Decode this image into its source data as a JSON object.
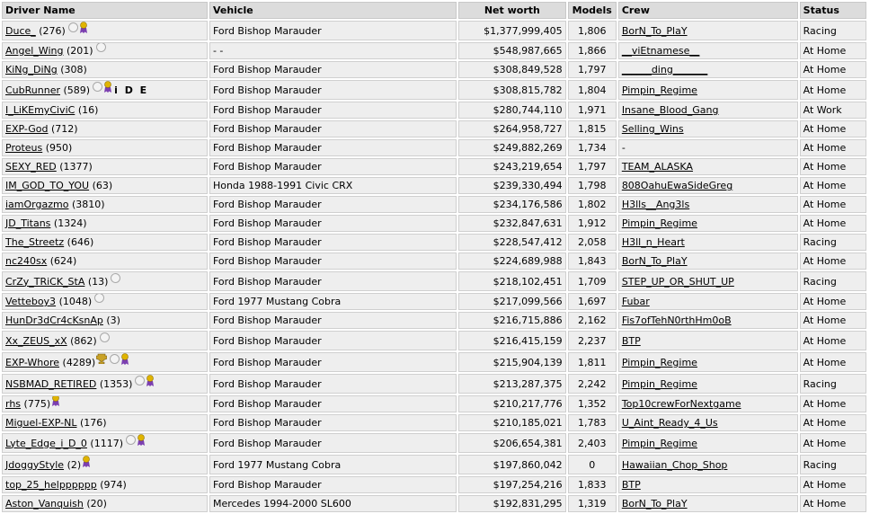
{
  "headers": {
    "driver": "Driver Name",
    "vehicle": "Vehicle",
    "networth": "Net worth",
    "models": "Models",
    "crew": "Crew",
    "status": "Status"
  },
  "rows": [
    {
      "driver": "Duce_",
      "rank": "(276)",
      "vehicle": "Ford Bishop Marauder",
      "networth": "$1,377,999,405",
      "models": "1,806",
      "crew": "BorN_To_PlaY",
      "status": "Racing",
      "coin": true,
      "award": true,
      "tall": true
    },
    {
      "driver": "Angel_Wing",
      "rank": "(201)",
      "vehicle": "- -",
      "networth": "$548,987,665",
      "models": "1,866",
      "crew": "__viEtnamese__",
      "status": "At Home",
      "coin": true
    },
    {
      "driver": "KiNg_DiNg",
      "rank": "(308)",
      "vehicle": "Ford Bishop Marauder",
      "networth": "$308,849,528",
      "models": "1,797",
      "crew": "______ding_______",
      "status": "At Home"
    },
    {
      "driver": "CubRunner",
      "rank": "(589)",
      "vehicle": "Ford Bishop Marauder",
      "networth": "$308,815,782",
      "models": "1,804",
      "crew": "Pimpin_Regime",
      "status": "At Home",
      "coin": true,
      "award": true,
      "ide": "i D E",
      "tall": true
    },
    {
      "driver": "I_LiKEmyCiviC",
      "rank": "(16)",
      "vehicle": "Ford Bishop Marauder",
      "networth": "$280,744,110",
      "models": "1,971",
      "crew": "Insane_Blood_Gang",
      "status": "At Work"
    },
    {
      "driver": "EXP-God",
      "rank": "(712)",
      "vehicle": "Ford Bishop Marauder",
      "networth": "$264,958,727",
      "models": "1,815",
      "crew": "Selling_Wins",
      "status": "At Home"
    },
    {
      "driver": "Proteus",
      "rank": "(950)",
      "vehicle": "Ford Bishop Marauder",
      "networth": "$249,882,269",
      "models": "1,734",
      "crew": "-",
      "crew_plain": true,
      "status": "At Home"
    },
    {
      "driver": "SEXY_RED",
      "rank": "(1377)",
      "vehicle": "Ford Bishop Marauder",
      "networth": "$243,219,654",
      "models": "1,797",
      "crew": "TEAM_ALASKA",
      "status": "At Home"
    },
    {
      "driver": "IM_GOD_TO_YOU",
      "rank": "(63)",
      "vehicle": "Honda 1988-1991 Civic CRX",
      "networth": "$239,330,494",
      "models": "1,798",
      "crew": "808OahuEwaSideGreg",
      "status": "At Home"
    },
    {
      "driver": "iamOrgazmo",
      "rank": "(3810)",
      "vehicle": "Ford Bishop Marauder",
      "networth": "$234,176,586",
      "models": "1,802",
      "crew": "H3lls__Ang3ls",
      "status": "At Home"
    },
    {
      "driver": "JD_Titans",
      "rank": "(1324)",
      "vehicle": "Ford Bishop Marauder",
      "networth": "$232,847,631",
      "models": "1,912",
      "crew": "Pimpin_Regime",
      "status": "At Home"
    },
    {
      "driver": "The_Streetz",
      "rank": "(646)",
      "vehicle": "Ford Bishop Marauder",
      "networth": "$228,547,412",
      "models": "2,058",
      "crew": "H3ll_n_Heart",
      "status": "Racing"
    },
    {
      "driver": "nc240sx",
      "rank": "(624)",
      "vehicle": "Ford Bishop Marauder",
      "networth": "$224,689,988",
      "models": "1,843",
      "crew": "BorN_To_PlaY",
      "status": "At Home"
    },
    {
      "driver": "CrZy_TRiCK_StA",
      "rank": "(13)",
      "vehicle": "Ford Bishop Marauder",
      "networth": "$218,102,451",
      "models": "1,709",
      "crew": "STEP_UP_OR_SHUT_UP",
      "status": "Racing",
      "coin": true,
      "tall": true
    },
    {
      "driver": "Vetteboy3",
      "rank": "(1048)",
      "vehicle": "Ford 1977 Mustang Cobra",
      "networth": "$217,099,566",
      "models": "1,697",
      "crew": "Fubar",
      "status": "At Home",
      "coin": true
    },
    {
      "driver": "HunDr3dCr4cKsnAp",
      "rank": "(3)",
      "vehicle": "Ford Bishop Marauder",
      "networth": "$216,715,886",
      "models": "2,162",
      "crew": "Fis7ofTehN0rthHm0oB",
      "status": "At Home"
    },
    {
      "driver": "Xx_ZEUS_xX",
      "rank": "(862)",
      "vehicle": "Ford Bishop Marauder",
      "networth": "$216,415,159",
      "models": "2,237",
      "crew": "BTP",
      "status": "At Home",
      "coin": true,
      "tall": true
    },
    {
      "driver": "EXP-Whore",
      "rank": "(4289)",
      "vehicle": "Ford Bishop Marauder",
      "networth": "$215,904,139",
      "models": "1,811",
      "crew": "Pimpin_Regime",
      "status": "At Home",
      "trophy": true,
      "coin": true,
      "award": true,
      "tall": true
    },
    {
      "driver": "NSBMAD_RETIRED",
      "rank": "(1353)",
      "vehicle": "Ford Bishop Marauder",
      "networth": "$213,287,375",
      "models": "2,242",
      "crew": "Pimpin_Regime",
      "status": "Racing",
      "coin": true,
      "award": true,
      "tall": true
    },
    {
      "driver": "rhs",
      "rank": "(775)",
      "vehicle": "Ford Bishop Marauder",
      "networth": "$210,217,776",
      "models": "1,352",
      "crew": "Top10crewForNextgame",
      "status": "At Home",
      "award": true
    },
    {
      "driver": "Miguel-EXP-NL",
      "rank": "(176)",
      "vehicle": "Ford Bishop Marauder",
      "networth": "$210,185,021",
      "models": "1,783",
      "crew": "U_Aint_Ready_4_Us",
      "status": "At Home"
    },
    {
      "driver": "Lyte_Edge_i_D_0",
      "rank": "(1117)",
      "vehicle": "Ford Bishop Marauder",
      "networth": "$206,654,381",
      "models": "2,403",
      "crew": "Pimpin_Regime",
      "status": "At Home",
      "coin": true,
      "award": true,
      "tall": true
    },
    {
      "driver": "JdoggyStyle",
      "rank": "(2)",
      "vehicle": "Ford 1977 Mustang Cobra",
      "networth": "$197,860,042",
      "models": "0",
      "crew": "Hawaiian_Chop_Shop",
      "status": "Racing",
      "award": true,
      "tall": true
    },
    {
      "driver": "top_25_helpppppp",
      "rank": "(974)",
      "vehicle": "Ford Bishop Marauder",
      "networth": "$197,254,216",
      "models": "1,833",
      "crew": "BTP",
      "status": "At Home"
    },
    {
      "driver": "Aston_Vanquish",
      "rank": "(20)",
      "vehicle": "Mercedes 1994-2000 SL600",
      "networth": "$192,831,295",
      "models": "1,319",
      "crew": "BorN_To_PlaY",
      "status": "At Home"
    }
  ],
  "colors": {
    "award_ribbon": "#7b3fb0",
    "award_medal": "#e0b400",
    "coin": "#f4f4f4",
    "header_bg": "#dcdcdc",
    "cell_bg": "#eeeeee"
  }
}
